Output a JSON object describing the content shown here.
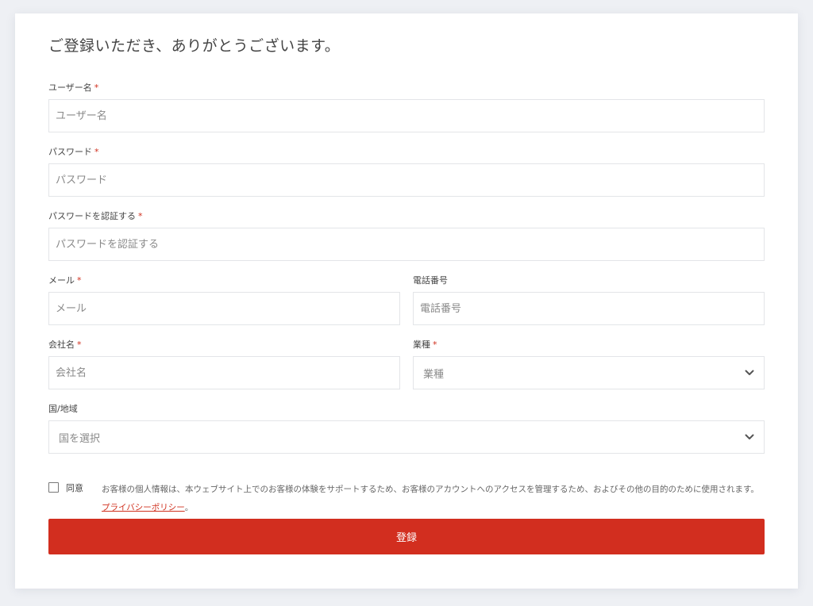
{
  "form": {
    "title": "ご登録いただき、ありがとうございます。",
    "required_mark": "*",
    "username": {
      "label": "ユーザー名",
      "placeholder": "ユーザー名"
    },
    "password": {
      "label": "パスワード",
      "placeholder": "パスワード"
    },
    "password_confirm": {
      "label": "パスワードを認証する",
      "placeholder": "パスワードを認証する"
    },
    "email": {
      "label": "メール",
      "placeholder": "メール"
    },
    "phone": {
      "label": "電話番号",
      "placeholder": "電話番号"
    },
    "company": {
      "label": "会社名",
      "placeholder": "会社名"
    },
    "industry": {
      "label": "業種",
      "selected": "業種"
    },
    "country": {
      "label": "国/地域",
      "selected": "国を選択"
    },
    "consent": {
      "checkbox_label": "同意",
      "text": "お客様の個人情報は、本ウェブサイト上でのお客様の体験をサポートするため、お客様のアカウントへのアクセスを管理するため、およびその他の目的のために使用されます。",
      "link_label": "プライバシーポリシー",
      "trailing": "。"
    },
    "submit_label": "登録"
  },
  "icons": {
    "dropdown": "chevron-down-icon"
  },
  "colors": {
    "accent": "#d22e1f",
    "required": "#d0301e",
    "page_bg": "#eef0f4"
  }
}
